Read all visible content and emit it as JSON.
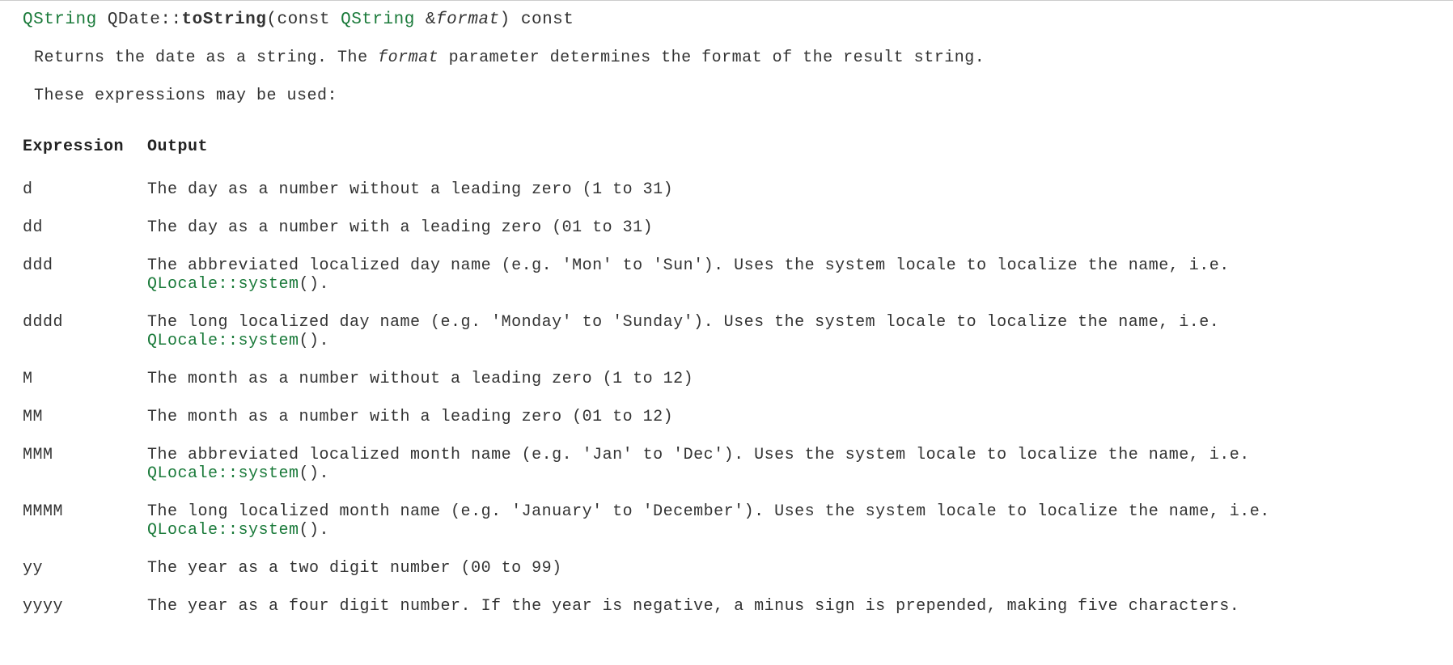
{
  "signature": {
    "return_type": "QString",
    "class_name": "QDate::",
    "method_name": "toString",
    "open": "(const ",
    "param_type": "QString",
    "amp": " &",
    "param_name": "format",
    "close": ") const"
  },
  "description": {
    "prefix": "Returns the date as a string. The ",
    "italic_word": "format",
    "suffix": " parameter determines the format of the result string."
  },
  "intro": "These expressions may be used:",
  "table": {
    "header_expr": "Expression",
    "header_out": "Output",
    "rows": [
      {
        "expr": "d",
        "out_pre": "The day as a number without a leading zero (1 to 31)",
        "link": "",
        "out_post": ""
      },
      {
        "expr": "dd",
        "out_pre": "The day as a number with a leading zero (01 to 31)",
        "link": "",
        "out_post": ""
      },
      {
        "expr": "ddd",
        "out_pre": "The abbreviated localized day name (e.g. 'Mon' to 'Sun'). Uses the system locale to localize the name, i.e. ",
        "link": "QLocale::system",
        "out_post": "()."
      },
      {
        "expr": "dddd",
        "out_pre": "The long localized day name (e.g. 'Monday' to 'Sunday'). Uses the system locale to localize the name, i.e. ",
        "link": "QLocale::system",
        "out_post": "()."
      },
      {
        "expr": "M",
        "out_pre": "The month as a number without a leading zero (1 to 12)",
        "link": "",
        "out_post": ""
      },
      {
        "expr": "MM",
        "out_pre": "The month as a number with a leading zero (01 to 12)",
        "link": "",
        "out_post": ""
      },
      {
        "expr": "MMM",
        "out_pre": "The abbreviated localized month name (e.g. 'Jan' to 'Dec'). Uses the system locale to localize the name, i.e. ",
        "link": "QLocale::system",
        "out_post": "()."
      },
      {
        "expr": "MMMM",
        "out_pre": "The long localized month name (e.g. 'January' to 'December'). Uses the system locale to localize the name, i.e. ",
        "link": "QLocale::system",
        "out_post": "()."
      },
      {
        "expr": "yy",
        "out_pre": "The year as a two digit number (00 to 99)",
        "link": "",
        "out_post": ""
      },
      {
        "expr": "yyyy",
        "out_pre": "The year as a four digit number. If the year is negative, a minus sign is prepended, making five characters.",
        "link": "",
        "out_post": ""
      }
    ]
  }
}
